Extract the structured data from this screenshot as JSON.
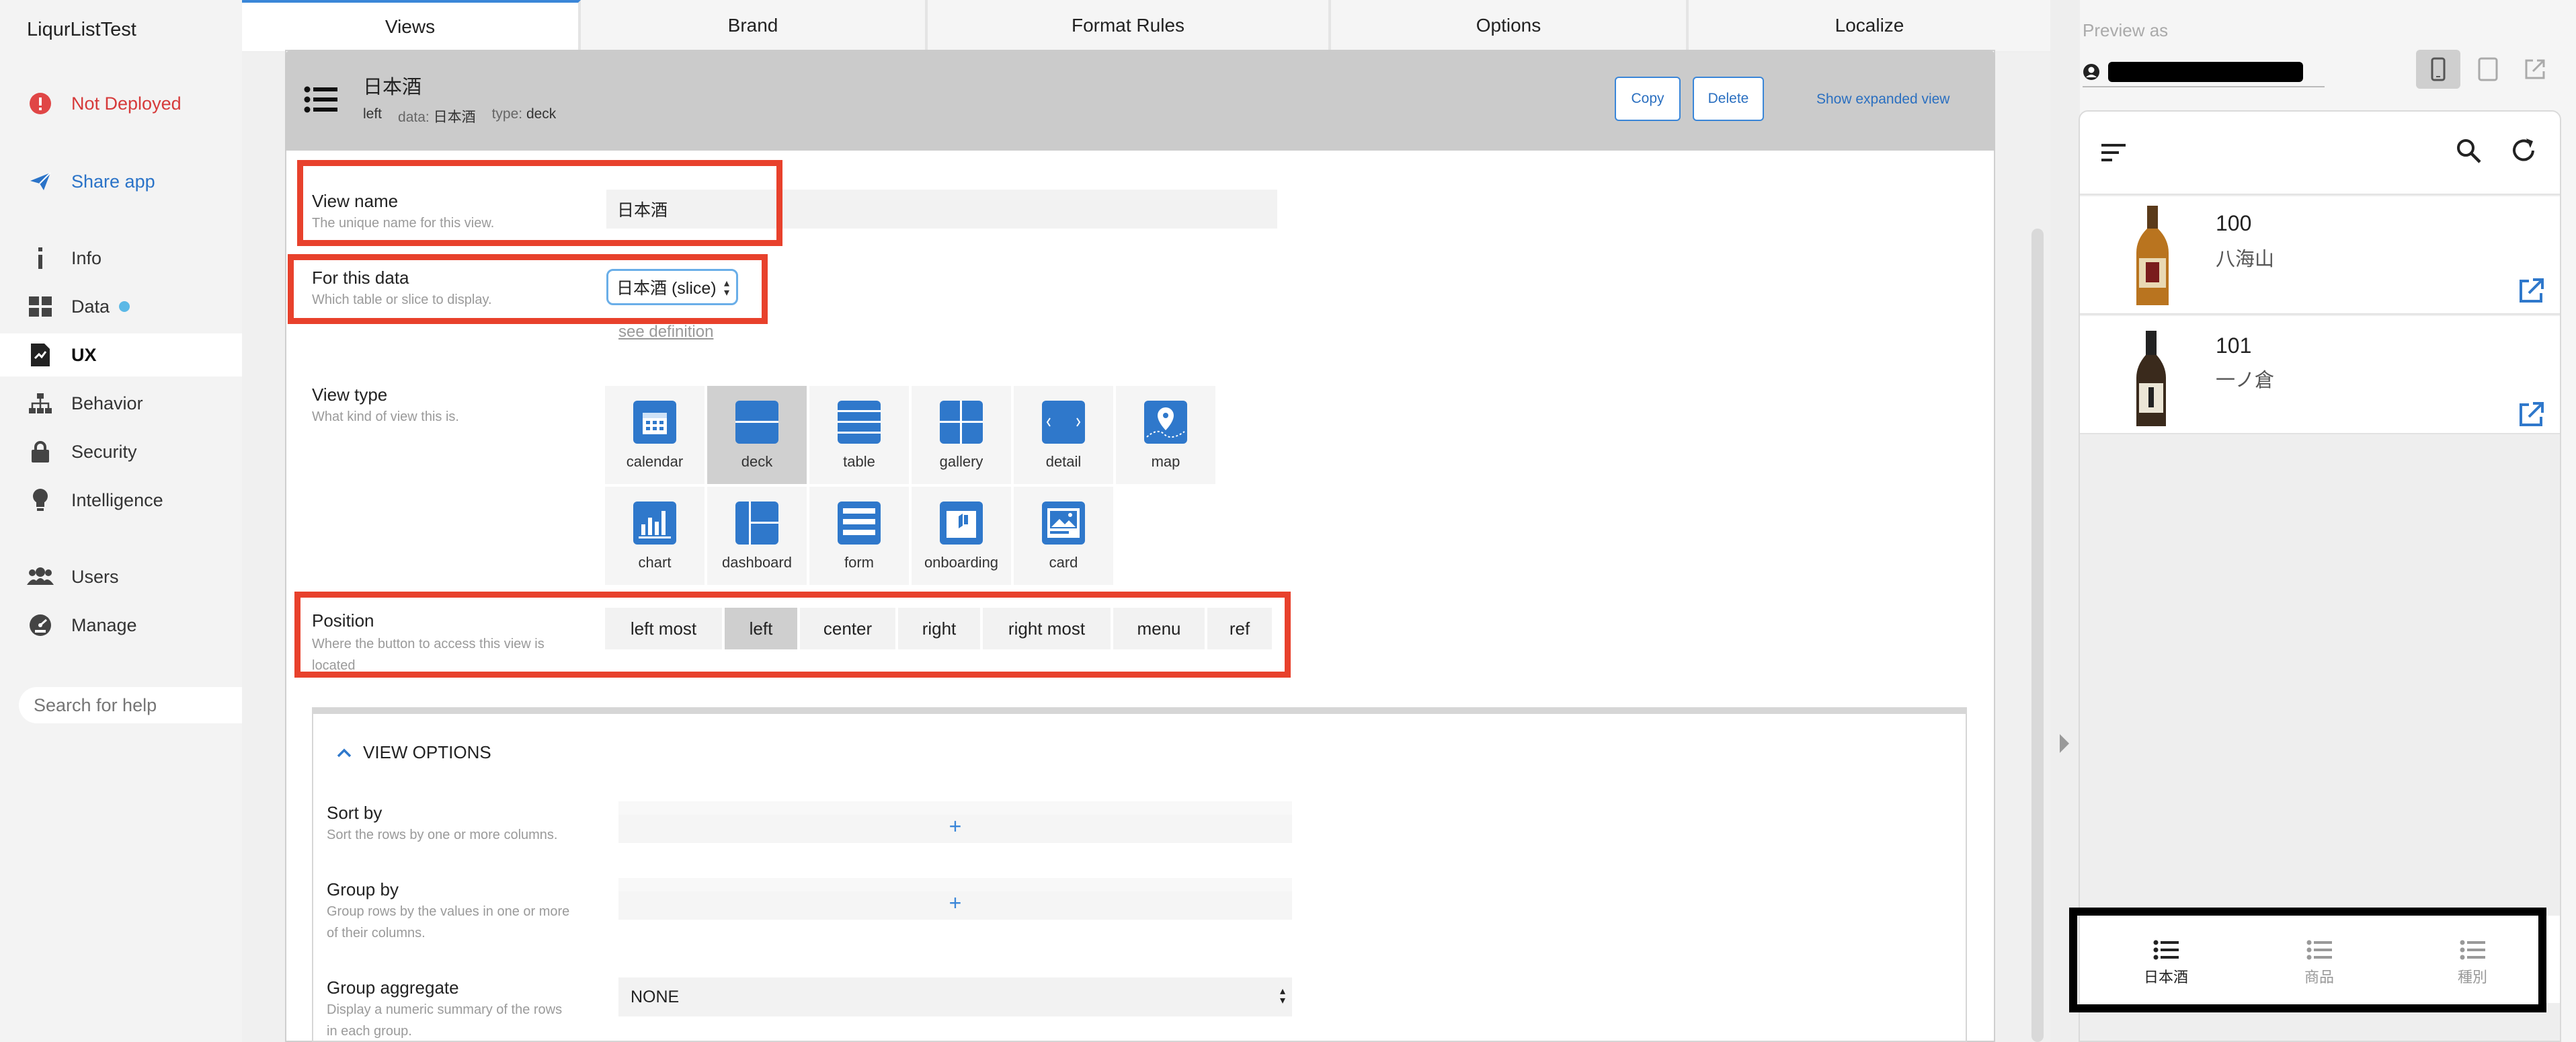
{
  "app": {
    "title": "LiqurListTest"
  },
  "sidebar": {
    "deploy_status": "Not Deployed",
    "share": "Share app",
    "items": [
      {
        "label": "Info"
      },
      {
        "label": "Data"
      },
      {
        "label": "UX"
      },
      {
        "label": "Behavior"
      },
      {
        "label": "Security"
      },
      {
        "label": "Intelligence"
      },
      {
        "label": "Users"
      },
      {
        "label": "Manage"
      }
    ],
    "search_placeholder": "Search for help"
  },
  "tabs": [
    {
      "label": "Views"
    },
    {
      "label": "Brand"
    },
    {
      "label": "Format Rules"
    },
    {
      "label": "Options"
    },
    {
      "label": "Localize"
    }
  ],
  "view": {
    "name": "日本酒",
    "position_meta_value": "left",
    "data_meta_key": "data:",
    "data_meta_value": "日本酒",
    "type_meta_key": "type:",
    "type_meta_value": "deck",
    "copy_label": "Copy",
    "delete_label": "Delete",
    "expand_label": "Show expanded view"
  },
  "form": {
    "view_name_label": "View name",
    "view_name_help": "The unique name for this view.",
    "view_name_value": "日本酒",
    "for_data_label": "For this data",
    "for_data_help": "Which table or slice to display.",
    "for_data_value": "日本酒 (slice)",
    "see_definition": "see definition",
    "view_type_label": "View type",
    "view_type_help": "What kind of view this is.",
    "view_types": [
      "calendar",
      "deck",
      "table",
      "gallery",
      "detail",
      "map",
      "chart",
      "dashboard",
      "form",
      "onboarding",
      "card"
    ],
    "view_type_selected": "deck",
    "position_label": "Position",
    "position_help_1": "Where the button to access this view is",
    "position_help_2": "located",
    "positions": [
      "left most",
      "left",
      "center",
      "right",
      "right most",
      "menu",
      "ref"
    ],
    "position_selected": "left"
  },
  "view_options": {
    "title": "VIEW OPTIONS",
    "sort_label": "Sort by",
    "sort_help": "Sort the rows by one or more columns.",
    "group_label": "Group by",
    "group_help_1": "Group rows by the values in one or more",
    "group_help_2": "of their columns.",
    "aggregate_label": "Group aggregate",
    "aggregate_help_1": "Display a numeric summary of the rows",
    "aggregate_help_2": "in each group.",
    "aggregate_value": "NONE",
    "add_symbol": "+"
  },
  "preview": {
    "title": "Preview as",
    "rows": [
      {
        "title": "100",
        "subtitle": "八海山"
      },
      {
        "title": "101",
        "subtitle": "一ノ倉"
      }
    ],
    "bottom_nav": [
      {
        "label": "日本酒",
        "active": true
      },
      {
        "label": "商品",
        "active": false
      },
      {
        "label": "種別",
        "active": false
      }
    ]
  },
  "colors": {
    "accent": "#2f78cb",
    "danger": "#d63a3a",
    "highlight_box": "#e8412c"
  }
}
